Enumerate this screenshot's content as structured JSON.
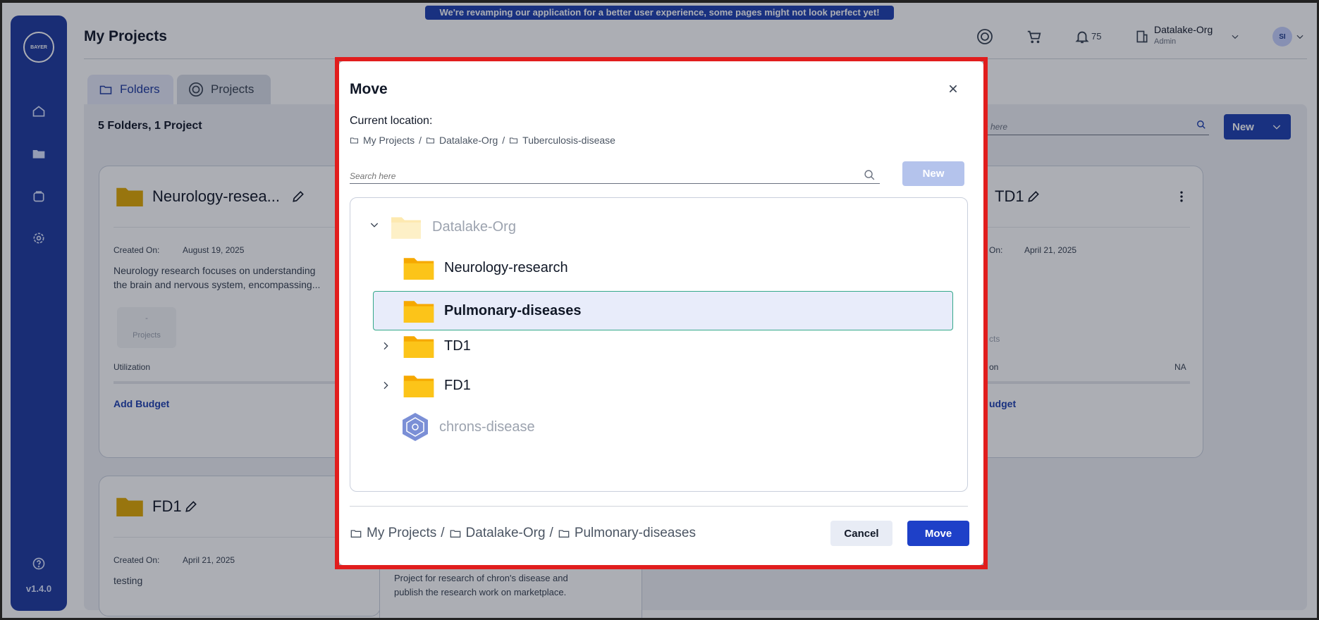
{
  "banner": "We're revamping our application for a better user experience, some pages might not look perfect yet!",
  "page_title": "My Projects",
  "sidebar": {
    "logo_text": "BAYER",
    "items": [
      {
        "icon": "home-icon"
      },
      {
        "icon": "folder-icon"
      },
      {
        "icon": "shopping-bag-icon"
      },
      {
        "icon": "gear-icon"
      }
    ],
    "help_icon": "help-icon",
    "version": "v1.4.0"
  },
  "header": {
    "notifications_count": "75",
    "org_name": "Datalake-Org",
    "org_role": "Admin",
    "avatar_initials": "SI"
  },
  "tabs": [
    {
      "label": "Folders",
      "active": true
    },
    {
      "label": "Projects",
      "active": false
    }
  ],
  "main": {
    "counts": "5 Folders, 1 Project",
    "search_placeholder": "Search here",
    "search_visible": "h here",
    "new_label": "New",
    "cards": [
      {
        "title": "Neurology-resea...",
        "created_label": "Created On:",
        "created_date": "August 19, 2025",
        "desc_line1": "Neurology research focuses on understanding",
        "desc_line2": "the brain and nervous system, encompassing...",
        "projects_count": "-",
        "projects_label": "Projects",
        "utilization_label": "Utilization",
        "add_budget": "Add Budget"
      },
      {
        "title": "TD1",
        "created_label": "On:",
        "created_date": "April 21, 2025",
        "projects_label": "cts",
        "utilization_label": "on",
        "utilization_value": "NA",
        "add_budget": "udget"
      },
      {
        "title": "FD1",
        "created_label": "Created On:",
        "created_date": "April 21, 2025",
        "desc": "testing"
      },
      {
        "desc_line1": "Project for research of chron's disease and",
        "desc_line2": "publish the research work on marketplace."
      }
    ]
  },
  "modal": {
    "title": "Move",
    "current_location_label": "Current location:",
    "current_path": [
      "My Projects",
      "Datalake-Org",
      "Tuberculosis-disease"
    ],
    "search_placeholder": "Search here",
    "new_label": "New",
    "tree": [
      {
        "label": "Datalake-Org",
        "expanded": true,
        "disabled": true
      },
      {
        "label": "Neurology-research"
      },
      {
        "label": "Pulmonary-diseases",
        "selected": true
      },
      {
        "label": "TD1",
        "collapsed": true
      },
      {
        "label": "FD1",
        "collapsed": true
      },
      {
        "label": "chrons-disease",
        "type": "project",
        "disabled": true
      }
    ],
    "target_path": [
      "My Projects",
      "Datalake-Org",
      "Pulmonary-diseases"
    ],
    "cancel_label": "Cancel",
    "move_label": "Move",
    "colors": {
      "highlight_border": "#e11d1d",
      "primary": "#1e40c8",
      "selected_bg": "#e8ecfa",
      "selected_border": "#34a88a",
      "folder": "#fbbf24"
    }
  }
}
